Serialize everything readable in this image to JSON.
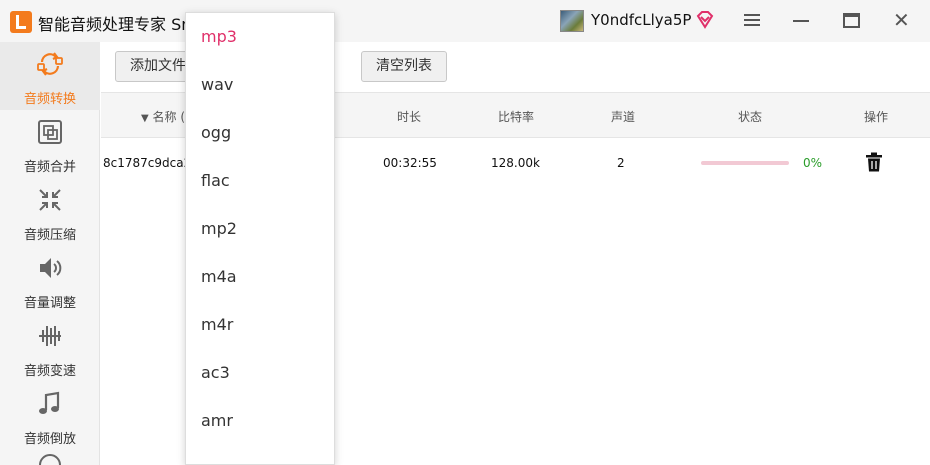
{
  "app": {
    "title": "智能音频处理专家 Sm",
    "user_name": "Y0ndfcLlya5P"
  },
  "colors": {
    "accent": "#f37b1d",
    "selected": "#e0306a",
    "progress_track": "#f2c9d4",
    "percent_text": "#2a9d2a"
  },
  "sidebar": {
    "items": [
      {
        "label": "音频转换",
        "icon": "convert-icon",
        "active": true
      },
      {
        "label": "音频合并",
        "icon": "merge-icon"
      },
      {
        "label": "音频压缩",
        "icon": "compress-icon"
      },
      {
        "label": "音量调整",
        "icon": "volume-icon"
      },
      {
        "label": "音频变速",
        "icon": "speed-icon"
      },
      {
        "label": "音频倒放",
        "icon": "reverse-icon"
      }
    ]
  },
  "toolbar": {
    "add_file_label": "添加文件",
    "clear_list_label": "清空列表"
  },
  "table": {
    "headers": {
      "name": "名称 (",
      "duration": "时长",
      "bitrate": "比特率",
      "channels": "声道",
      "status": "状态",
      "action": "操作"
    },
    "rows": [
      {
        "name": "8c1787c9dca2",
        "duration": "00:32:55",
        "bitrate": "128.00k",
        "channels": "2",
        "progress": 0,
        "percent": "0%"
      }
    ]
  },
  "format_dropdown": {
    "selected": "mp3",
    "options": [
      "mp3",
      "wav",
      "ogg",
      "flac",
      "mp2",
      "m4a",
      "m4r",
      "ac3",
      "amr"
    ]
  }
}
